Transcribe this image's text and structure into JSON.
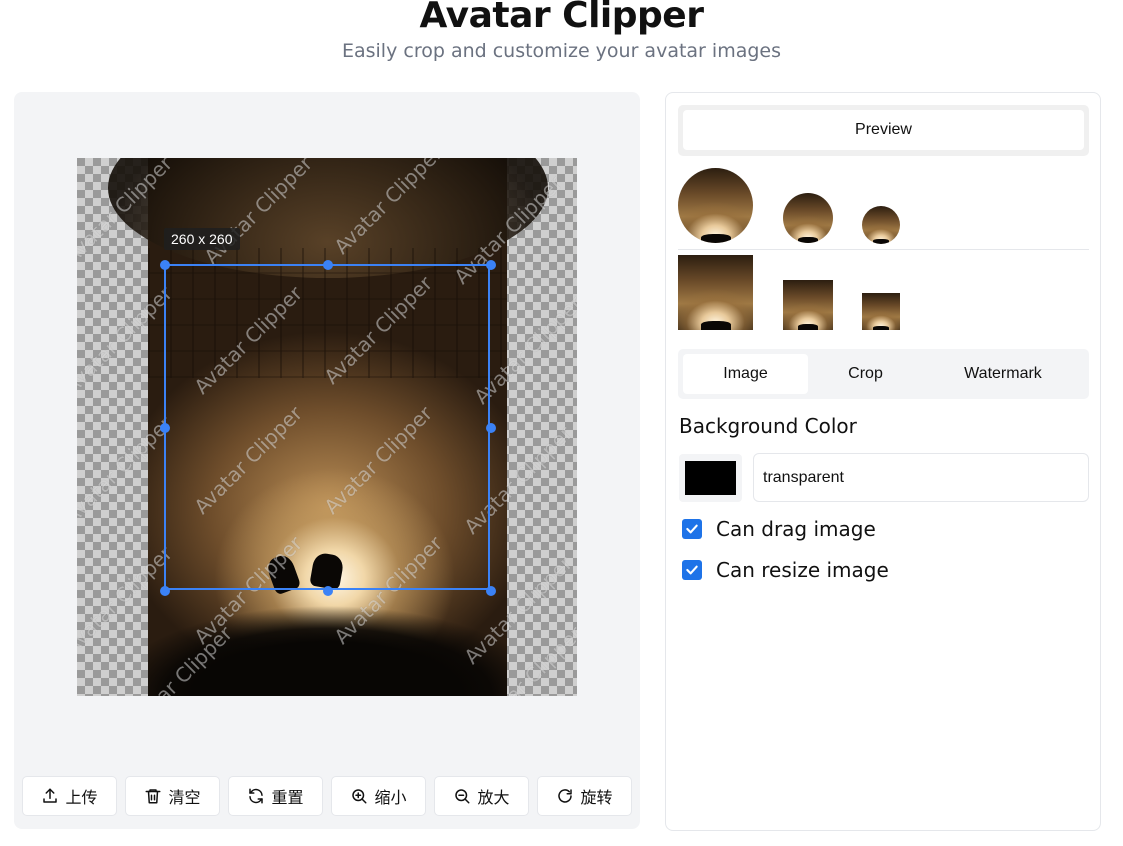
{
  "header": {
    "title": "Avatar Clipper",
    "subtitle": "Easily crop and customize your avatar images"
  },
  "editor": {
    "size_label": "260 x 260",
    "watermark_text": "Avatar Clipper",
    "toolbar": {
      "upload": "上传",
      "clear": "清空",
      "reset": "重置",
      "zoom_out": "缩小",
      "zoom_in": "放大",
      "rotate": "旋转"
    }
  },
  "settings": {
    "preview_tab": "Preview",
    "tabs": [
      "Image",
      "Crop",
      "Watermark"
    ],
    "active_tab": "Image",
    "background_color_label": "Background Color",
    "background_color_value": "transparent",
    "swatch_color": "#000000",
    "can_drag_label": "Can drag image",
    "can_drag": true,
    "can_resize_label": "Can resize image",
    "can_resize": true
  },
  "colors": {
    "accent": "#3b82f6",
    "checkbox": "#1e73e8",
    "panel_bg": "#f3f4f6"
  }
}
